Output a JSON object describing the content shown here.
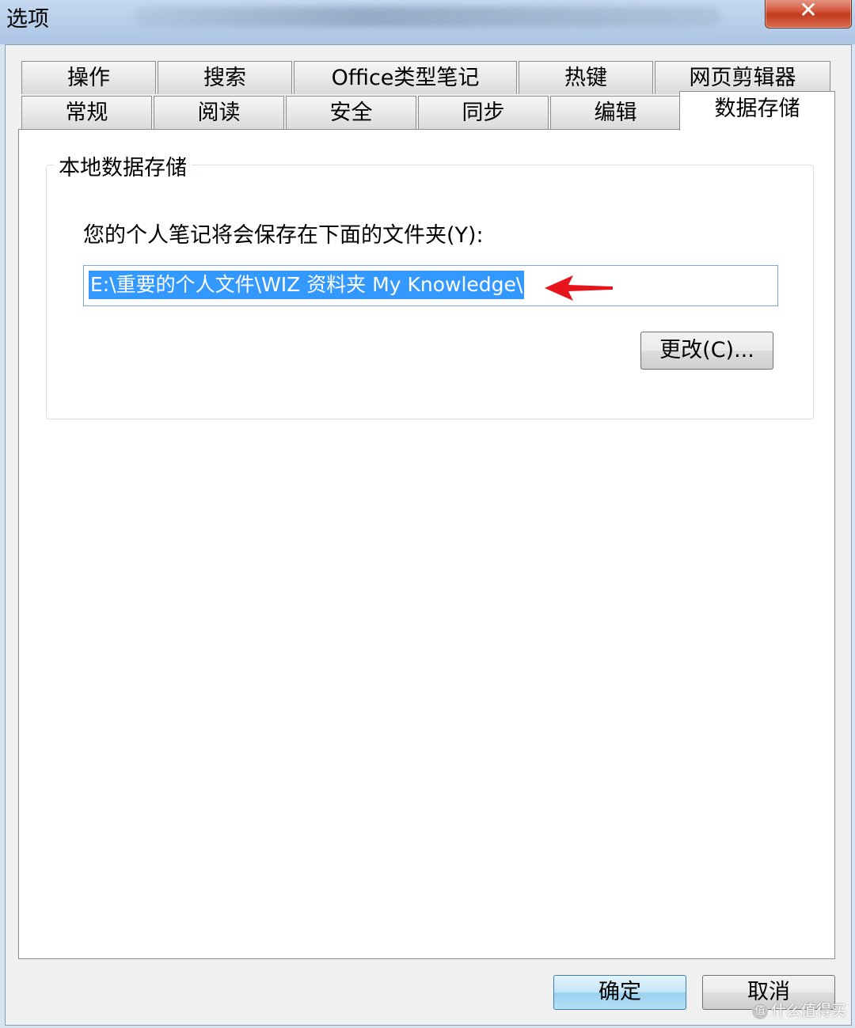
{
  "window": {
    "title": "选项",
    "close_glyph": "✕"
  },
  "tabs_row_top": [
    {
      "label": "操作"
    },
    {
      "label": "搜索"
    },
    {
      "label": "Office类型笔记"
    },
    {
      "label": "热键"
    },
    {
      "label": "网页剪辑器"
    }
  ],
  "tabs_row_bottom": [
    {
      "label": "常规"
    },
    {
      "label": "阅读"
    },
    {
      "label": "安全"
    },
    {
      "label": "同步"
    },
    {
      "label": "编辑"
    },
    {
      "label": "数据存储",
      "active": true
    }
  ],
  "storage": {
    "group_title": "本地数据存储",
    "folder_label": "您的个人笔记将会保存在下面的文件夹(Y):",
    "folder_path": "E:\\重要的个人文件\\WIZ 资料夹 My Knowledge\\",
    "change_button": "更改(C)..."
  },
  "footer": {
    "ok_button": "确定",
    "cancel_button": "取消"
  },
  "watermark": {
    "text": "什么值得买",
    "logo_glyph": "值"
  },
  "colors": {
    "selection": "#3399ff",
    "arrow": "#e8141b",
    "close_button": "#c23b20"
  },
  "icons": {
    "annotation_arrow": "red-left-arrow"
  }
}
